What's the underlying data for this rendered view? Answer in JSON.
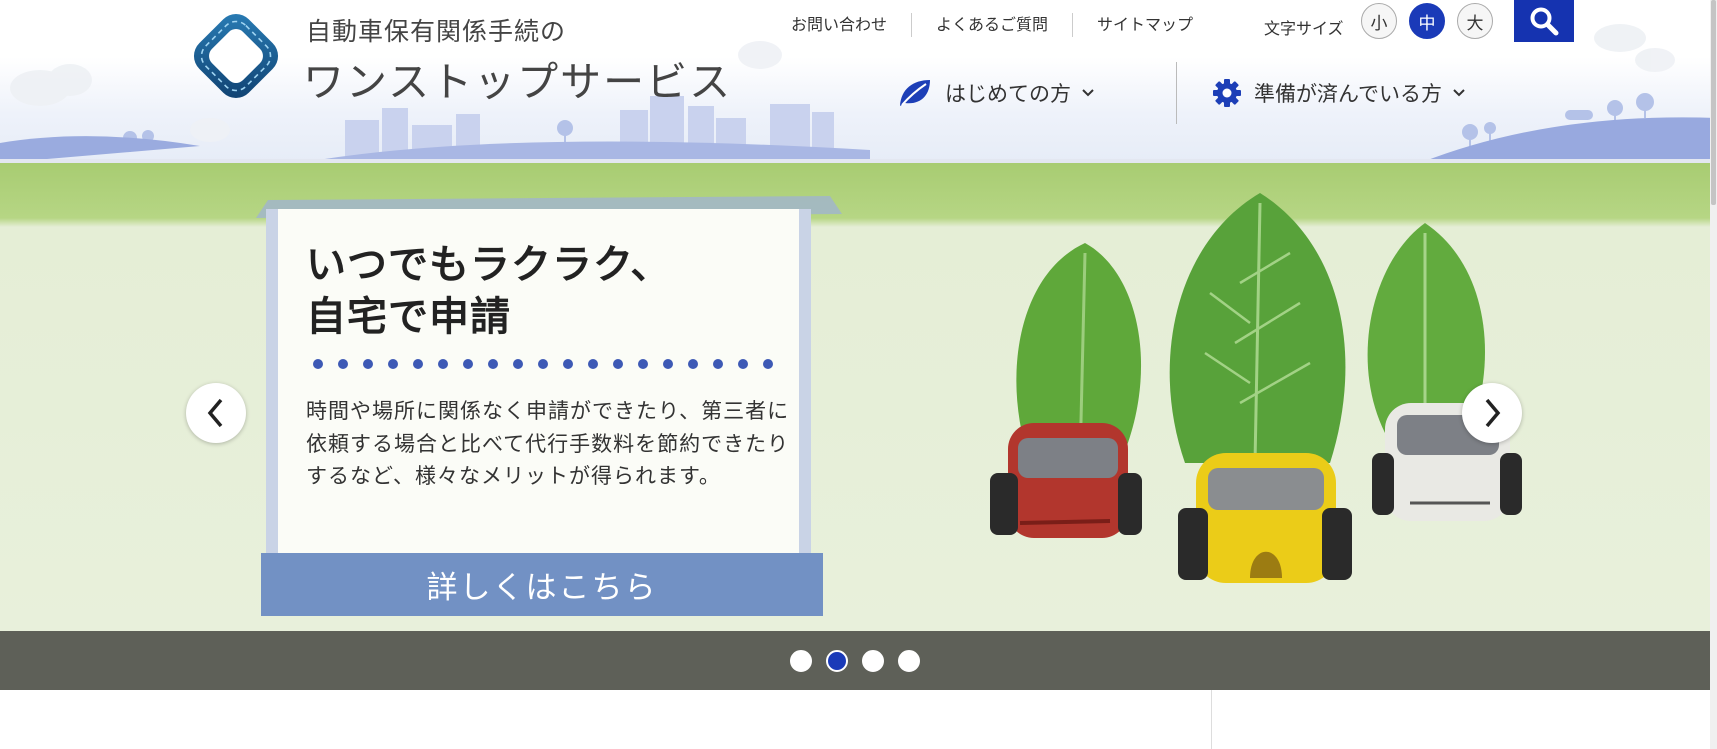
{
  "header": {
    "site_title_line1": "自動車保有関係手続の",
    "site_title_line2": "ワンストップサービス",
    "utility_links": [
      "お問い合わせ",
      "よくあるご質問",
      "サイトマップ"
    ],
    "font_size": {
      "label": "文字サイズ",
      "options": [
        "小",
        "中",
        "大"
      ],
      "selected": "中"
    },
    "main_nav": [
      {
        "label": "はじめての方",
        "icon": "leaf-icon"
      },
      {
        "label": "準備が済んでいる方",
        "icon": "gear-icon"
      }
    ]
  },
  "hero": {
    "headline_line1": "いつでもラクラク、",
    "headline_line2": "自宅で申請",
    "body": "時間や場所に関係なく申請ができたり、第三者に依頼する場合と比べて代行手数料を節約できたりするなど、様々なメリットが得られます。",
    "button_label": "詳しくはこちら",
    "slide_count": 4,
    "active_slide": 2
  },
  "colors": {
    "accent": "#1a3ab8",
    "button": "#7291c4",
    "pager_bar": "#5e6058",
    "hero_green": "#a8cc72"
  }
}
